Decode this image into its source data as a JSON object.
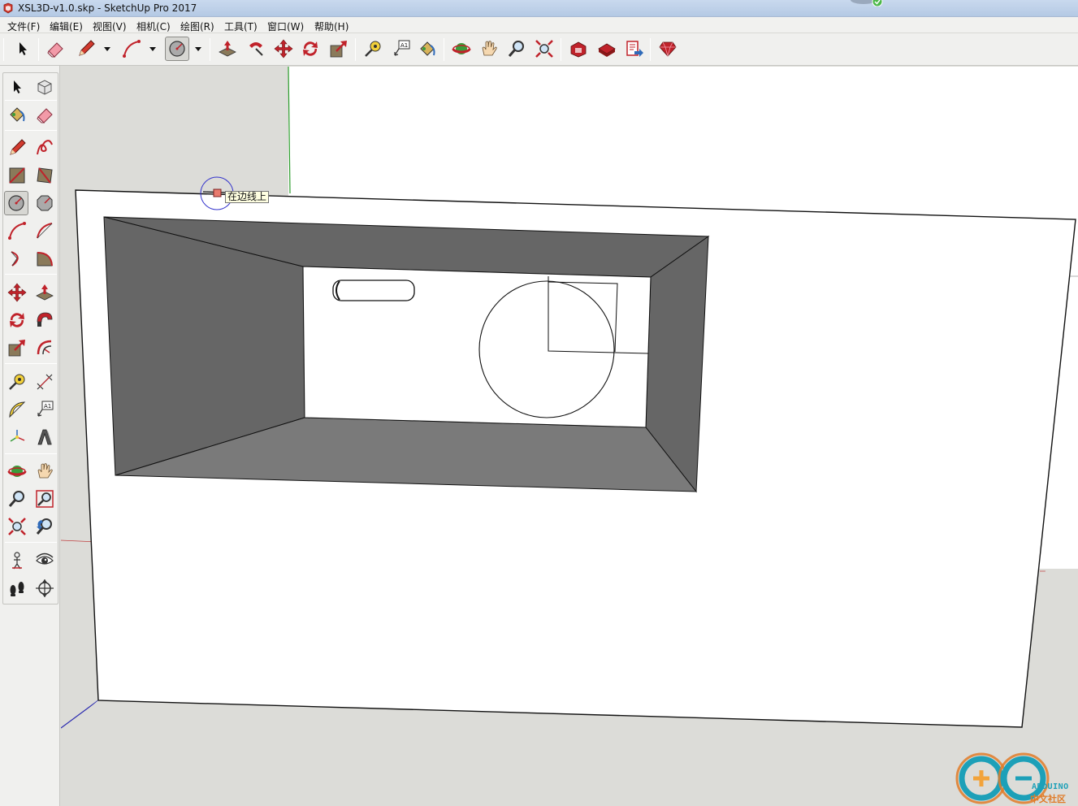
{
  "window": {
    "title": "XSL3D-v1.0.skp - SketchUp Pro 2017"
  },
  "menu": [
    "文件(F)",
    "编辑(E)",
    "视图(V)",
    "相机(C)",
    "绘图(R)",
    "工具(T)",
    "窗口(W)",
    "帮助(H)"
  ],
  "top_toolbar": [
    "select-icon",
    "eraser-icon",
    "pencil-icon",
    "dropdown-arrow-icon",
    "arc-icon",
    "dropdown-arrow-icon",
    "circle-icon",
    "dropdown-arrow-icon",
    "push-pull-icon",
    "follow-me-icon",
    "move-icon",
    "rotate-icon",
    "scale-icon",
    "tape-measure-icon",
    "text-label-icon",
    "paint-bucket-icon",
    "orbit-icon",
    "pan-icon",
    "zoom-icon",
    "zoom-extents-icon",
    "warehouse-icon",
    "extension-warehouse-icon",
    "send-to-layout-icon",
    "ruby-console-icon"
  ],
  "left_toolbar": [
    "select-icon",
    "make-component-icon",
    "paint-bucket-icon",
    "eraser-icon",
    "pencil-icon",
    "freehand-icon",
    "rectangle-icon",
    "rotated-rectangle-icon",
    "circle-icon",
    "polygon-icon",
    "arc-icon",
    "two-point-arc-icon",
    "three-point-arc-icon",
    "pie-icon",
    "move-icon",
    "push-pull-icon",
    "rotate-icon",
    "follow-me-icon",
    "scale-icon",
    "offset-icon",
    "tape-measure-icon",
    "dimension-icon",
    "protractor-icon",
    "text-icon",
    "axes-icon",
    "3d-text-icon",
    "orbit-icon",
    "pan-icon",
    "zoom-icon",
    "zoom-window-icon",
    "zoom-extents-icon",
    "previous-view-icon",
    "position-camera-icon",
    "look-around-icon",
    "walk-icon",
    "section-plane-icon"
  ],
  "tooltip": {
    "text": "在边线上"
  },
  "watermark": {
    "word": "ARDUINO",
    "cn": "中文社区"
  },
  "colors": {
    "viewport_bg": "#dcdcd8",
    "box_face": "#ffffff",
    "dark_face": "#666666",
    "mid_face": "#7a7a7a",
    "inference_point": "#e97b6e",
    "inference_circle": "#3333cc"
  }
}
